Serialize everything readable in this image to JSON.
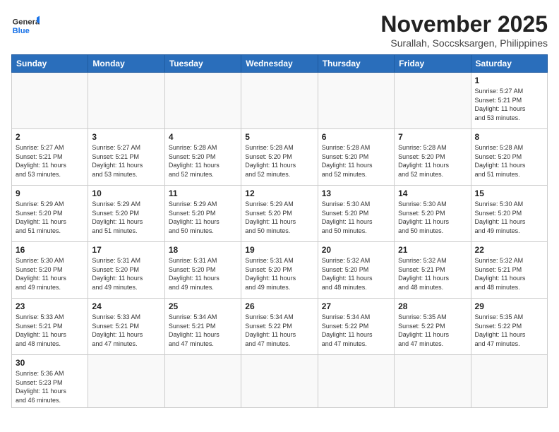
{
  "header": {
    "logo_line1": "General",
    "logo_line2": "Blue",
    "month": "November 2025",
    "location": "Surallah, Soccsksargen, Philippines"
  },
  "weekdays": [
    "Sunday",
    "Monday",
    "Tuesday",
    "Wednesday",
    "Thursday",
    "Friday",
    "Saturday"
  ],
  "weeks": [
    [
      {
        "day": "",
        "info": ""
      },
      {
        "day": "",
        "info": ""
      },
      {
        "day": "",
        "info": ""
      },
      {
        "day": "",
        "info": ""
      },
      {
        "day": "",
        "info": ""
      },
      {
        "day": "",
        "info": ""
      },
      {
        "day": "1",
        "info": "Sunrise: 5:27 AM\nSunset: 5:21 PM\nDaylight: 11 hours\nand 53 minutes."
      }
    ],
    [
      {
        "day": "2",
        "info": "Sunrise: 5:27 AM\nSunset: 5:21 PM\nDaylight: 11 hours\nand 53 minutes."
      },
      {
        "day": "3",
        "info": "Sunrise: 5:27 AM\nSunset: 5:21 PM\nDaylight: 11 hours\nand 53 minutes."
      },
      {
        "day": "4",
        "info": "Sunrise: 5:28 AM\nSunset: 5:20 PM\nDaylight: 11 hours\nand 52 minutes."
      },
      {
        "day": "5",
        "info": "Sunrise: 5:28 AM\nSunset: 5:20 PM\nDaylight: 11 hours\nand 52 minutes."
      },
      {
        "day": "6",
        "info": "Sunrise: 5:28 AM\nSunset: 5:20 PM\nDaylight: 11 hours\nand 52 minutes."
      },
      {
        "day": "7",
        "info": "Sunrise: 5:28 AM\nSunset: 5:20 PM\nDaylight: 11 hours\nand 52 minutes."
      },
      {
        "day": "8",
        "info": "Sunrise: 5:28 AM\nSunset: 5:20 PM\nDaylight: 11 hours\nand 51 minutes."
      }
    ],
    [
      {
        "day": "9",
        "info": "Sunrise: 5:29 AM\nSunset: 5:20 PM\nDaylight: 11 hours\nand 51 minutes."
      },
      {
        "day": "10",
        "info": "Sunrise: 5:29 AM\nSunset: 5:20 PM\nDaylight: 11 hours\nand 51 minutes."
      },
      {
        "day": "11",
        "info": "Sunrise: 5:29 AM\nSunset: 5:20 PM\nDaylight: 11 hours\nand 50 minutes."
      },
      {
        "day": "12",
        "info": "Sunrise: 5:29 AM\nSunset: 5:20 PM\nDaylight: 11 hours\nand 50 minutes."
      },
      {
        "day": "13",
        "info": "Sunrise: 5:30 AM\nSunset: 5:20 PM\nDaylight: 11 hours\nand 50 minutes."
      },
      {
        "day": "14",
        "info": "Sunrise: 5:30 AM\nSunset: 5:20 PM\nDaylight: 11 hours\nand 50 minutes."
      },
      {
        "day": "15",
        "info": "Sunrise: 5:30 AM\nSunset: 5:20 PM\nDaylight: 11 hours\nand 49 minutes."
      }
    ],
    [
      {
        "day": "16",
        "info": "Sunrise: 5:30 AM\nSunset: 5:20 PM\nDaylight: 11 hours\nand 49 minutes."
      },
      {
        "day": "17",
        "info": "Sunrise: 5:31 AM\nSunset: 5:20 PM\nDaylight: 11 hours\nand 49 minutes."
      },
      {
        "day": "18",
        "info": "Sunrise: 5:31 AM\nSunset: 5:20 PM\nDaylight: 11 hours\nand 49 minutes."
      },
      {
        "day": "19",
        "info": "Sunrise: 5:31 AM\nSunset: 5:20 PM\nDaylight: 11 hours\nand 49 minutes."
      },
      {
        "day": "20",
        "info": "Sunrise: 5:32 AM\nSunset: 5:20 PM\nDaylight: 11 hours\nand 48 minutes."
      },
      {
        "day": "21",
        "info": "Sunrise: 5:32 AM\nSunset: 5:21 PM\nDaylight: 11 hours\nand 48 minutes."
      },
      {
        "day": "22",
        "info": "Sunrise: 5:32 AM\nSunset: 5:21 PM\nDaylight: 11 hours\nand 48 minutes."
      }
    ],
    [
      {
        "day": "23",
        "info": "Sunrise: 5:33 AM\nSunset: 5:21 PM\nDaylight: 11 hours\nand 48 minutes."
      },
      {
        "day": "24",
        "info": "Sunrise: 5:33 AM\nSunset: 5:21 PM\nDaylight: 11 hours\nand 47 minutes."
      },
      {
        "day": "25",
        "info": "Sunrise: 5:34 AM\nSunset: 5:21 PM\nDaylight: 11 hours\nand 47 minutes."
      },
      {
        "day": "26",
        "info": "Sunrise: 5:34 AM\nSunset: 5:22 PM\nDaylight: 11 hours\nand 47 minutes."
      },
      {
        "day": "27",
        "info": "Sunrise: 5:34 AM\nSunset: 5:22 PM\nDaylight: 11 hours\nand 47 minutes."
      },
      {
        "day": "28",
        "info": "Sunrise: 5:35 AM\nSunset: 5:22 PM\nDaylight: 11 hours\nand 47 minutes."
      },
      {
        "day": "29",
        "info": "Sunrise: 5:35 AM\nSunset: 5:22 PM\nDaylight: 11 hours\nand 47 minutes."
      }
    ],
    [
      {
        "day": "30",
        "info": "Sunrise: 5:36 AM\nSunset: 5:23 PM\nDaylight: 11 hours\nand 46 minutes."
      },
      {
        "day": "",
        "info": ""
      },
      {
        "day": "",
        "info": ""
      },
      {
        "day": "",
        "info": ""
      },
      {
        "day": "",
        "info": ""
      },
      {
        "day": "",
        "info": ""
      },
      {
        "day": "",
        "info": ""
      }
    ]
  ]
}
